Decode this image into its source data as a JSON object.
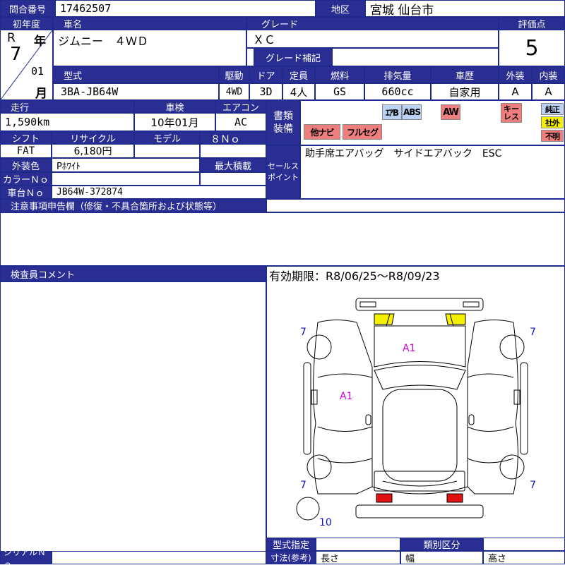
{
  "labels": {
    "inquiry_no": "問合番号",
    "region": "地区",
    "first_reg": "初年度",
    "car_name": "車名",
    "grade": "グレード",
    "score": "評価点",
    "year": "年",
    "month": "月",
    "grade_supplement": "グレード補記",
    "model_type": "型式",
    "drive": "駆動",
    "doors": "ドア",
    "capacity": "定員",
    "fuel": "燃料",
    "displacement": "排気量",
    "car_history": "車歴",
    "exterior": "外装",
    "interior": "内装",
    "mileage": "走行",
    "inspection": "車検",
    "aircon": "エアコン",
    "equipment": "書類装備",
    "shift": "シフト",
    "recycle": "リサイクル",
    "model": "モデル",
    "exterior_color": "外装色",
    "max_load": "最大積載",
    "color_no": "カラーＮｏ",
    "chassis_no": "車台Ｎｏ",
    "sales_point": "セールスポイント",
    "notes_header": "注意事項申告欄（修復・不具合箇所および状態等）",
    "inspector_comment": "検査員コメント",
    "serial_no": "シリアルＮｏ",
    "type_designation": "型式指定",
    "category": "類別区分",
    "dimensions": "寸法(参考)",
    "length": "長さ",
    "width": "幅",
    "height": "高さ"
  },
  "values": {
    "inquiry_no": "17462507",
    "region": "宮城 仙台市",
    "era": "R",
    "year": "7",
    "month": "01",
    "car_name": "ジムニー　４ＷＤ",
    "grade": "ＸＣ",
    "score": "5",
    "model_type": "3BA-JB64W",
    "drive": "4WD",
    "doors": "3D",
    "capacity": "4人",
    "fuel": "GS",
    "displacement": "660cc",
    "car_history": "自家用",
    "exterior": "A",
    "interior": "A",
    "mileage": "1,590km",
    "inspection": "10年01月",
    "aircon": "AC",
    "shift": "FAT",
    "recycle": "6,180円",
    "model_no": "８Ｎｏ",
    "exterior_color": "Pﾎﾜｲﾄ",
    "chassis_no": "JB64W-372874",
    "sales_point_text": "助手席エアバッグ　サイドエアバック　ESC",
    "validity": "有効期限：R8/06/25～R8/09/23"
  },
  "equipment_tags": {
    "airbag": "ｴｱB",
    "abs": "ABS",
    "aw": "AW",
    "keyless": "キーレス",
    "genuine": "純正",
    "aftermarket": "社外",
    "unknown": "不明",
    "other_navi": "他ナビ",
    "full_seg": "フルセグ"
  },
  "diagram_marks": {
    "hood": "A1",
    "left_side": "A1",
    "tire_front_left": "7",
    "tire_front_right": "7",
    "tire_rear_left": "7",
    "tire_rear_right": "7",
    "spare_tire": "10"
  },
  "colors": {
    "header_bg": "#2a2e93",
    "tag_blue": "#bcd2f5",
    "tag_red": "#f07e7e",
    "tag_yellow": "#f5f000",
    "mark_magenta": "#d400d4",
    "mark_blue": "#1010c0"
  }
}
